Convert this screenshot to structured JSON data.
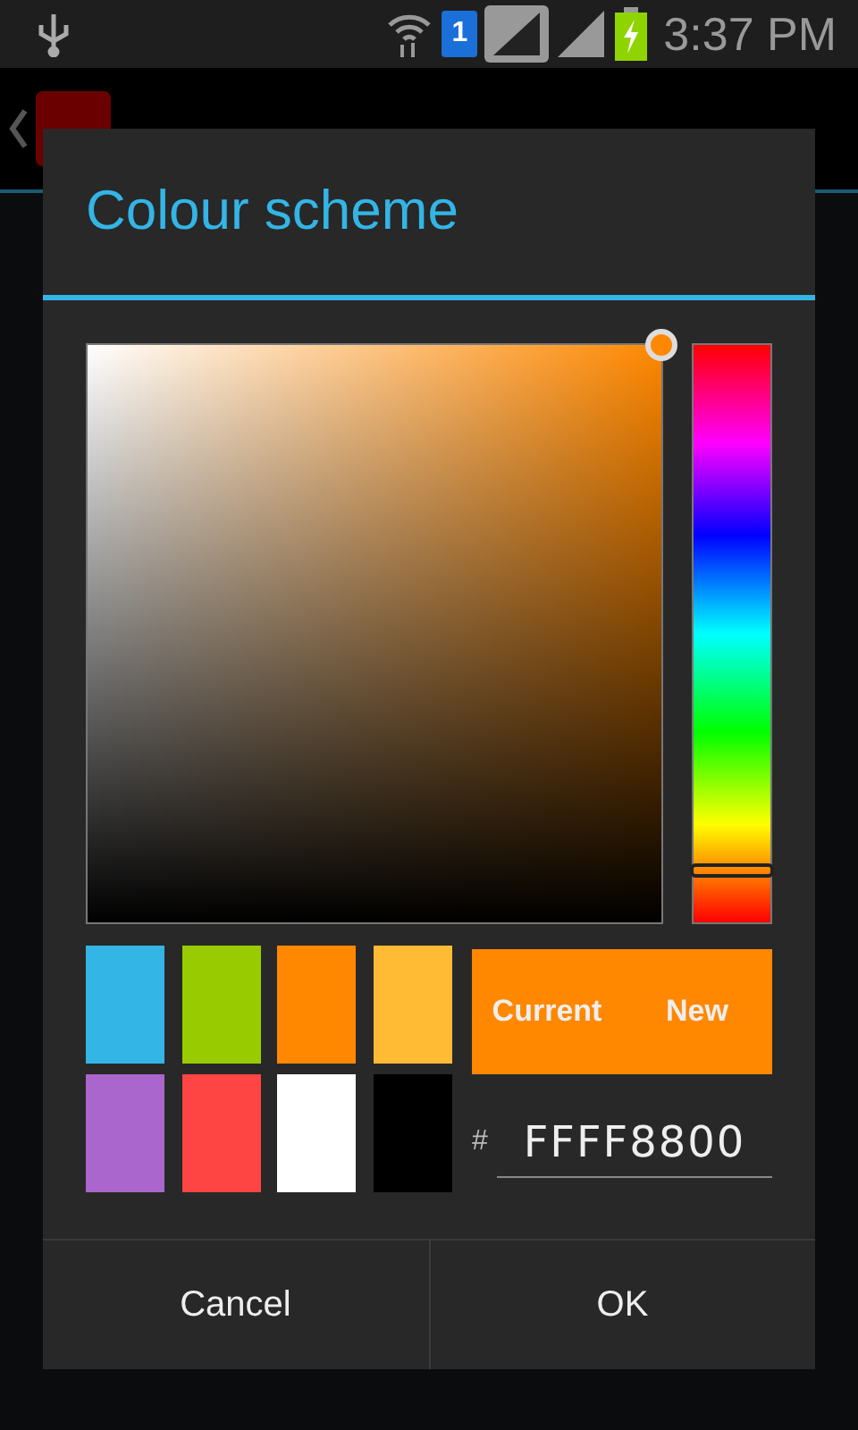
{
  "status_bar": {
    "time": "3:37 PM",
    "sim_slot": "1"
  },
  "dialog": {
    "title": "Colour scheme",
    "picker": {
      "hex": "FFFF8800",
      "hex_prefix": "#"
    },
    "hue_slider": {
      "level": 0.09
    },
    "swatches": [
      {
        "color": "#33b5e5"
      },
      {
        "color": "#99cc00"
      },
      {
        "color": "#ff8800"
      },
      {
        "color": "#ffbb33"
      },
      {
        "color": "#aa66cc"
      },
      {
        "color": "#ff4444"
      },
      {
        "color": "#ffffff"
      },
      {
        "color": "#000000"
      }
    ],
    "preview": [
      {
        "label": "Current",
        "color": "#ff8800"
      },
      {
        "label": "New",
        "color": "#ff8800"
      }
    ],
    "buttons": [
      "Cancel",
      "OK"
    ]
  }
}
